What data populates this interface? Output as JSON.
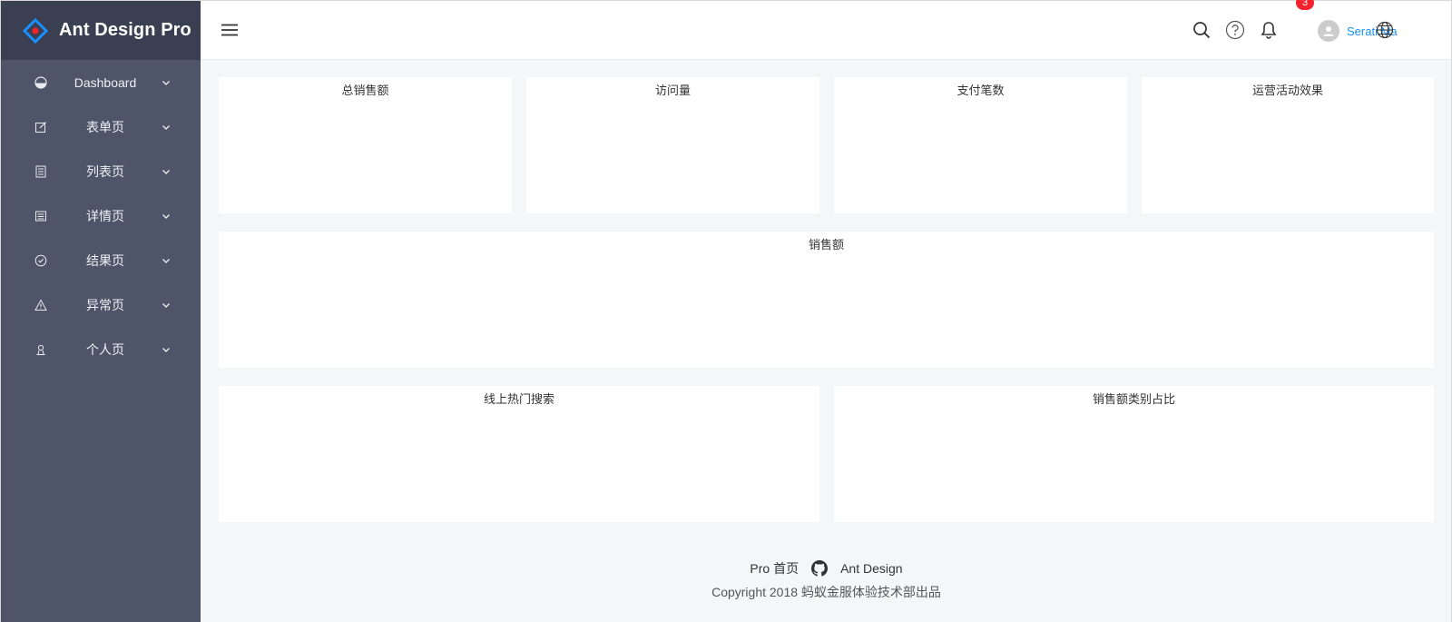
{
  "brand": {
    "title": "Ant Design Pro"
  },
  "sidebar": {
    "items": [
      {
        "label": "Dashboard",
        "icon": "dashboard-icon"
      },
      {
        "label": "表单页",
        "icon": "form-icon"
      },
      {
        "label": "列表页",
        "icon": "list-icon"
      },
      {
        "label": "详情页",
        "icon": "profile-icon"
      },
      {
        "label": "结果页",
        "icon": "check-circle-icon"
      },
      {
        "label": "异常页",
        "icon": "warning-icon"
      },
      {
        "label": "个人页",
        "icon": "user-icon"
      }
    ]
  },
  "header": {
    "notification_count": "3",
    "username": "Serati Ma"
  },
  "cards": {
    "total_sales": "总销售额",
    "visits": "访问量",
    "payments": "支付笔数",
    "operations": "运营活动效果",
    "sales": "销售额",
    "hot_search": "线上热门搜索",
    "sales_category": "销售额类别占比"
  },
  "footer": {
    "link_pro": "Pro 首页",
    "link_antd": "Ant Design",
    "copyright": "Copyright 2018 蚂蚁金服体验技术部出品"
  },
  "colors": {
    "sidebar_bg": "#4f5568",
    "brand_bg": "#3a3f51",
    "accent": "#1890ff",
    "badge": "#f5222d"
  }
}
